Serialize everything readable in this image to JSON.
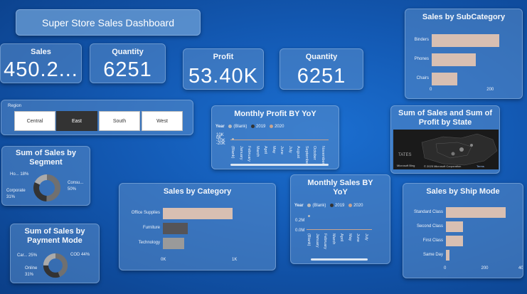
{
  "header": {
    "title": "Super Store Sales Dashboard"
  },
  "cards": {
    "sales": {
      "label": "Sales",
      "value": "450.2..."
    },
    "quantity1": {
      "label": "Quantity",
      "value": "6251"
    },
    "profit": {
      "label": "Profit",
      "value": "53.40K"
    },
    "quantity2": {
      "label": "Quantity",
      "value": "6251"
    }
  },
  "region": {
    "label": "Region",
    "options": [
      "Central",
      "East",
      "South",
      "West"
    ],
    "selected": "East"
  },
  "colors": {
    "bar": "#d8bfb2",
    "dark": "#555458",
    "gray": "#9a9a9a",
    "donut_a": "#707070",
    "donut_b": "#333333",
    "donut_c": "#aaaaaa"
  },
  "chart_data": [
    {
      "id": "subcategory",
      "type": "bar",
      "title": "Sales by SubCategory",
      "categories": [
        "Binders",
        "Phones",
        "Chairs"
      ],
      "values": [
        265,
        175,
        100
      ],
      "xticks": [
        "0",
        "200"
      ],
      "xlim": [
        0,
        300
      ]
    },
    {
      "id": "category",
      "type": "bar",
      "title": "Sales by Category",
      "categories": [
        "Office Supplies",
        "Furniture",
        "Technology"
      ],
      "values": [
        980,
        350,
        300
      ],
      "xticks": [
        "0K",
        "1K"
      ],
      "xlim": [
        0,
        1000
      ]
    },
    {
      "id": "shipmode",
      "type": "bar",
      "title": "Sales by Ship Mode",
      "categories": [
        "Standard Class",
        "Second Class",
        "First Class",
        "Same Day"
      ],
      "values": [
        320,
        90,
        90,
        20
      ],
      "xticks": [
        "0",
        "200",
        "400"
      ],
      "xlim": [
        0,
        400
      ]
    },
    {
      "id": "segment",
      "type": "pie",
      "title": "Sum of Sales by Segment",
      "labels": [
        "Consu...",
        "Corporate",
        "Ho..."
      ],
      "values": [
        50,
        31,
        18
      ],
      "value_labels": [
        "50%",
        "31%",
        "18%"
      ]
    },
    {
      "id": "payment",
      "type": "pie",
      "title": "Sum of Sales by Payment Mode",
      "labels": [
        "COD",
        "Online",
        "Car..."
      ],
      "values": [
        44,
        31,
        25
      ],
      "value_labels": [
        "44%",
        "31%",
        "25%"
      ]
    },
    {
      "id": "monthly_profit",
      "type": "line",
      "title": "Monthly Profit BY YoY",
      "legend_title": "Year",
      "series": [
        {
          "name": "(Blank)"
        },
        {
          "name": "2019"
        },
        {
          "name": "2020"
        }
      ],
      "yticks": [
        "10K",
        "0K",
        "-10K",
        "-20K"
      ],
      "categories": [
        "(Blank)",
        "January",
        "February",
        "March",
        "April",
        "May",
        "June",
        "July",
        "August",
        "September",
        "October",
        "November"
      ]
    },
    {
      "id": "monthly_sales",
      "type": "line",
      "title": "Monthly Sales BY YoY",
      "legend_title": "Year",
      "series": [
        {
          "name": "(Blank)"
        },
        {
          "name": "2019"
        },
        {
          "name": "2020"
        }
      ],
      "yticks": [
        "0.2M",
        "0.0M"
      ],
      "categories": [
        "(Blank)",
        "January",
        "February",
        "March",
        "April",
        "May",
        "June",
        "July"
      ]
    }
  ],
  "map": {
    "title": "Sum of Sales and Sum of Profit by State",
    "label": "TATES",
    "credit": "© 2025 Microsoft Corporation",
    "terms": "Terms",
    "brand": "Microsoft Bing"
  },
  "monthly_profit_legend_labels": {
    "blank": "(Blank)",
    "y2019": "2019",
    "y2020": "2020"
  }
}
